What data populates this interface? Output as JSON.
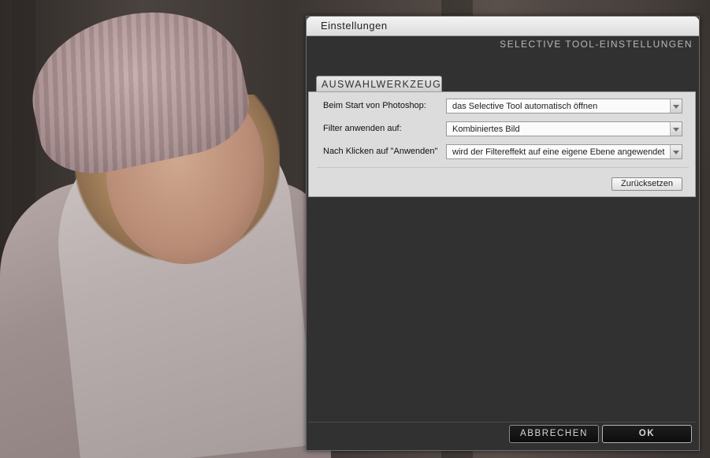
{
  "dialog": {
    "title": "Einstellungen",
    "header_label": "SELECTIVE TOOL-EINSTELLUNGEN",
    "tab": "AUSWAHLWERKZEUG",
    "settings": [
      {
        "label": "Beim Start von Photoshop:",
        "value": "das Selective Tool automatisch öffnen"
      },
      {
        "label": "Filter anwenden auf:",
        "value": "Kombiniertes Bild"
      },
      {
        "label": "Nach Klicken auf \"Anwenden\"",
        "value": "wird der Filtereffekt auf eine eigene Ebene angewendet"
      }
    ],
    "reset_label": "Zurücksetzen",
    "cancel_label": "ABBRECHEN",
    "ok_label": "OK"
  }
}
